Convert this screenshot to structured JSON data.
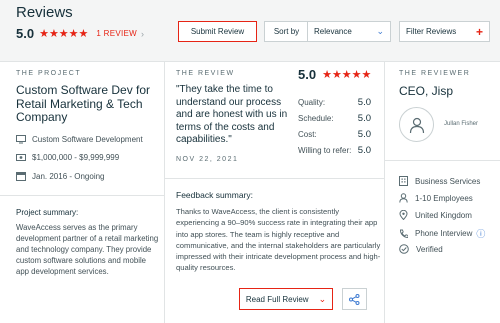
{
  "header": {
    "title": "Reviews",
    "rating": "5.0",
    "stars": "★★★★★",
    "review_count": "1 REVIEW",
    "review_chevron": "›",
    "submit_label": "Submit Review",
    "sort_label": "Sort by",
    "sort_value": "Relevance",
    "filter_label": "Filter Reviews",
    "accent_color": "#e62415"
  },
  "project": {
    "section_label": "THE PROJECT",
    "title": "Custom Software Dev for Retail Marketing & Tech Company",
    "service": "Custom Software Development",
    "budget": "$1,000,000 - $9,999,999",
    "dates": "Jan. 2016 - Ongoing",
    "summary_label": "Project summary:",
    "summary": "WaveAccess serves as the primary development partner of a retail marketing and technology company. They provide custom software solutions and mobile app development services."
  },
  "review": {
    "section_label": "THE REVIEW",
    "quote": "\"They take the time to understand our process and are honest with us in terms of the costs and capabilities.\"",
    "date": "NOV 22, 2021",
    "overall": "5.0",
    "stars": "★★★★★",
    "scores": [
      {
        "label": "Quality:",
        "value": "5.0"
      },
      {
        "label": "Schedule:",
        "value": "5.0"
      },
      {
        "label": "Cost:",
        "value": "5.0"
      },
      {
        "label": "Willing to refer:",
        "value": "5.0"
      }
    ],
    "feedback_label": "Feedback summary:",
    "feedback": "Thanks to WaveAccess, the client is consistently experiencing a 90–90% success rate in integrating their app into app stores. The team is highly receptive and communicative, and the internal stakeholders are particularly impressed with their intricate development process and high-quality resources.",
    "read_full_label": "Read Full Review"
  },
  "reviewer": {
    "section_label": "THE REVIEWER",
    "name": "CEO, Jisp",
    "person": "Jullan Fisher",
    "industry": "Business Services",
    "employees": "1-10 Employees",
    "location": "United Kingdom",
    "interview": "Phone Interview",
    "verified": "Verified"
  }
}
